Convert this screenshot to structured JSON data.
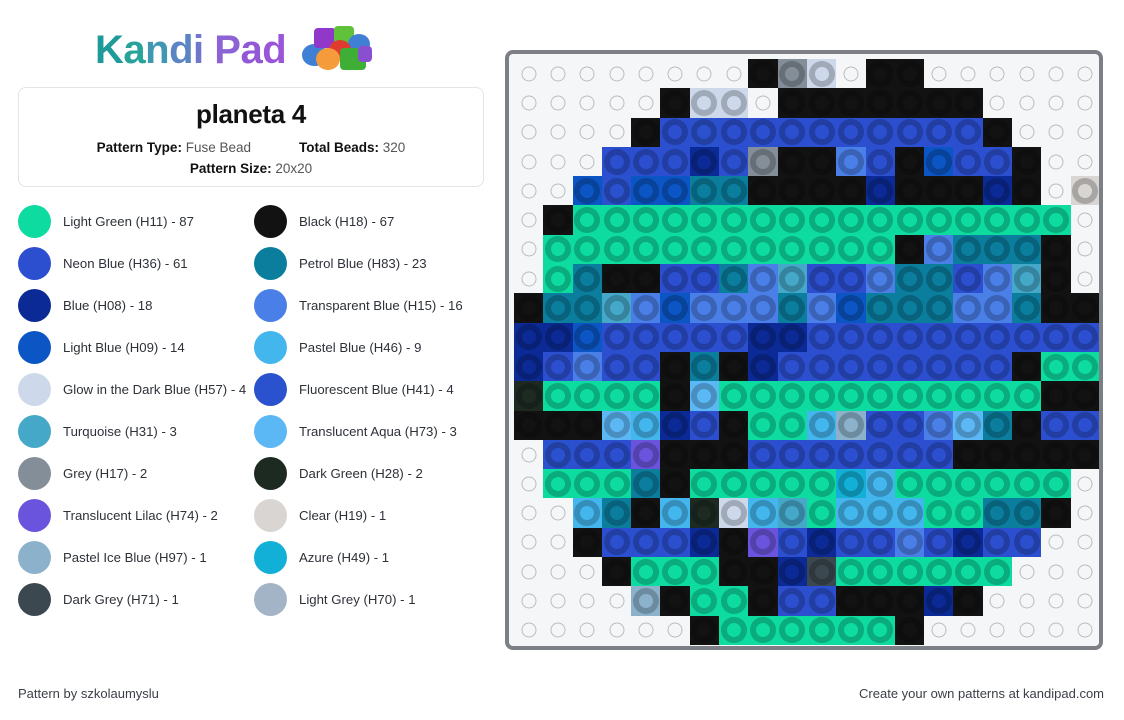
{
  "brand": {
    "name_part1": "Kandi",
    "name_part2": "Pad",
    "logo_icon": "bead-pile-icon"
  },
  "info": {
    "title": "planeta 4",
    "pattern_type_label": "Pattern Type:",
    "pattern_type_value": "Fuse Bead",
    "total_beads_label": "Total Beads:",
    "total_beads_value": "320",
    "pattern_size_label": "Pattern Size:",
    "pattern_size_value": "20x20"
  },
  "legend": [
    {
      "key": "H11",
      "label": "Light Green (H11) - 87",
      "color": "#0ddba0"
    },
    {
      "key": "H18",
      "label": "Black (H18) - 67",
      "color": "#121212"
    },
    {
      "key": "H36",
      "label": "Neon Blue (H36) - 61",
      "color": "#2c4fd0"
    },
    {
      "key": "H83",
      "label": "Petrol Blue (H83) - 23",
      "color": "#0b7e9e"
    },
    {
      "key": "H08",
      "label": "Blue (H08) - 18",
      "color": "#0b2a96"
    },
    {
      "key": "H15",
      "label": "Transparent Blue (H15) - 16",
      "color": "#4a7fe8"
    },
    {
      "key": "H09",
      "label": "Light Blue (H09) - 14",
      "color": "#0b55c4"
    },
    {
      "key": "H46",
      "label": "Pastel Blue (H46) - 9",
      "color": "#44b6ee"
    },
    {
      "key": "H57",
      "label": "Glow in the Dark Blue (H57) - 4",
      "color": "#cdd9ea"
    },
    {
      "key": "H41",
      "label": "Fluorescent Blue (H41) - 4",
      "color": "#2a52ce"
    },
    {
      "key": "H31",
      "label": "Turquoise (H31) - 3",
      "color": "#45a8c9"
    },
    {
      "key": "H73",
      "label": "Translucent Aqua (H73) - 3",
      "color": "#5cb7f5"
    },
    {
      "key": "H17",
      "label": "Grey (H17) - 2",
      "color": "#838e99"
    },
    {
      "key": "H28",
      "label": "Dark Green (H28) - 2",
      "color": "#1d2a22"
    },
    {
      "key": "H74",
      "label": "Translucent Lilac (H74) - 2",
      "color": "#6a54dd"
    },
    {
      "key": "H19",
      "label": "Clear (H19) - 1",
      "color": "#d8d5d2"
    },
    {
      "key": "H97",
      "label": "Pastel Ice Blue (H97) - 1",
      "color": "#8cb2cb"
    },
    {
      "key": "H49",
      "label": "Azure (H49) - 1",
      "color": "#12b0d6"
    },
    {
      "key": "H71",
      "label": "Dark Grey (H71) - 1",
      "color": "#3b4850"
    },
    {
      "key": "H70",
      "label": "Light Grey (H70) - 1",
      "color": "#a3b4c6"
    }
  ],
  "pattern": {
    "rows": 20,
    "cols": 20,
    "palette": {
      "G": "#0ddba0",
      "K": "#121212",
      "N": "#2c4fd0",
      "P": "#0b7e9e",
      "B": "#0b2a96",
      "T": "#4a7fe8",
      "L": "#0b55c4",
      "S": "#44b6ee",
      "W": "#cdd9ea",
      "F": "#2a52ce",
      "Q": "#45a8c9",
      "A": "#5cb7f5",
      "Y": "#838e99",
      "D": "#1d2a22",
      "V": "#6a54dd",
      "C": "#d8d5d2",
      "I": "#8cb2cb",
      "Z": "#12b0d6",
      "X": "#3b4850",
      "E": "#a3b4c6",
      ".": null
    },
    "grid": [
      "........KYW.KK......",
      ".....KWW.KKKKKKK....",
      "....KNFNNNNNNNNNK...",
      "...NNNBNYKKTNKLNNK..",
      "..LFLLPPKKKKBKKKBK.C",
      ".KGGGGGGGGGGGGGGGGG.",
      ".GGGGGGGGGGGGKTPPPK.",
      ".GPKKNNPTQNNTPPNTQK.",
      "KPPQTLTTTPTLPPPTTPKK",
      "BBLNNNNNBBNNNNNNNNNN",
      "BNTNNKPKBNNNNNNNNKGG",
      "DGGGGKAGGGGGGGGGGGKK",
      "KKKASBNKGGSINNTAPKNN",
      ".FNNVKKKNNNNNNNKKKKK",
      ".GGGPKGGGGGZSGGGGGG.",
      "..SPKSDWSQGSSSGGPPK.",
      "..KNNNBKVNBNNTNBNN..",
      "...KGGGKKBXGGGGGG...",
      "....IKGGKNNKKKBK....",
      "......KGGGGGGK......"
    ]
  },
  "footer": {
    "left": "Pattern by szkolaumyslu",
    "right": "Create your own patterns at kandipad.com"
  }
}
